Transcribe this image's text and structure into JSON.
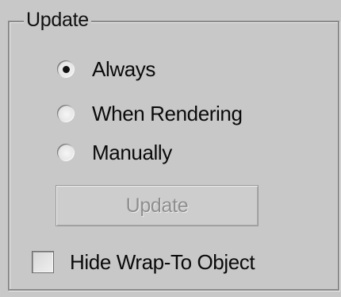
{
  "group": {
    "title": "Update"
  },
  "radios": [
    {
      "label": "Always",
      "checked": true
    },
    {
      "label": "When Rendering",
      "checked": false
    },
    {
      "label": "Manually",
      "checked": false
    }
  ],
  "update_button": {
    "label": "Update",
    "enabled": false
  },
  "checkbox": {
    "label": "Hide Wrap-To Object",
    "checked": false
  }
}
